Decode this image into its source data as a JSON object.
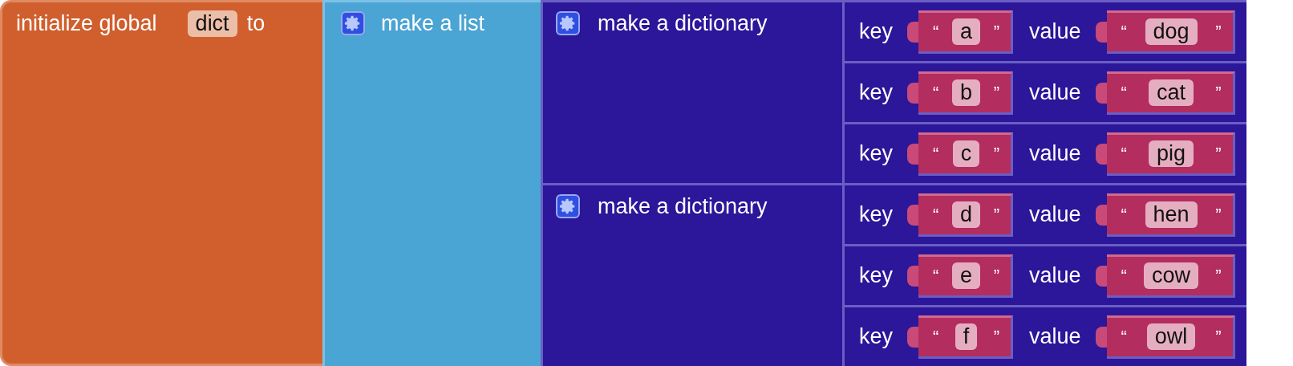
{
  "variable": {
    "prefix": "initialize global",
    "name": "dict",
    "suffix": "to"
  },
  "list": {
    "label": "make a list"
  },
  "dictionaries": [
    {
      "label": "make a dictionary",
      "pairs": [
        {
          "key_label": "key",
          "key": {
            "open": "“",
            "text": "a",
            "close": "”"
          },
          "value_label": "value",
          "value": {
            "open": "“",
            "text": "dog",
            "close": "”"
          }
        },
        {
          "key_label": "key",
          "key": {
            "open": "“",
            "text": "b",
            "close": "”"
          },
          "value_label": "value",
          "value": {
            "open": "“",
            "text": "cat",
            "close": "”"
          }
        },
        {
          "key_label": "key",
          "key": {
            "open": "“",
            "text": "c",
            "close": "”"
          },
          "value_label": "value",
          "value": {
            "open": "“",
            "text": "pig",
            "close": "”"
          }
        }
      ]
    },
    {
      "label": "make a dictionary",
      "pairs": [
        {
          "key_label": "key",
          "key": {
            "open": "“",
            "text": "d",
            "close": "”"
          },
          "value_label": "value",
          "value": {
            "open": "“",
            "text": "hen",
            "close": "”"
          }
        },
        {
          "key_label": "key",
          "key": {
            "open": "“",
            "text": "e",
            "close": "”"
          },
          "value_label": "value",
          "value": {
            "open": "“",
            "text": "cow",
            "close": "”"
          }
        },
        {
          "key_label": "key",
          "key": {
            "open": "“",
            "text": "f",
            "close": "”"
          },
          "value_label": "value",
          "value": {
            "open": "“",
            "text": "owl",
            "close": "”"
          }
        }
      ]
    }
  ]
}
